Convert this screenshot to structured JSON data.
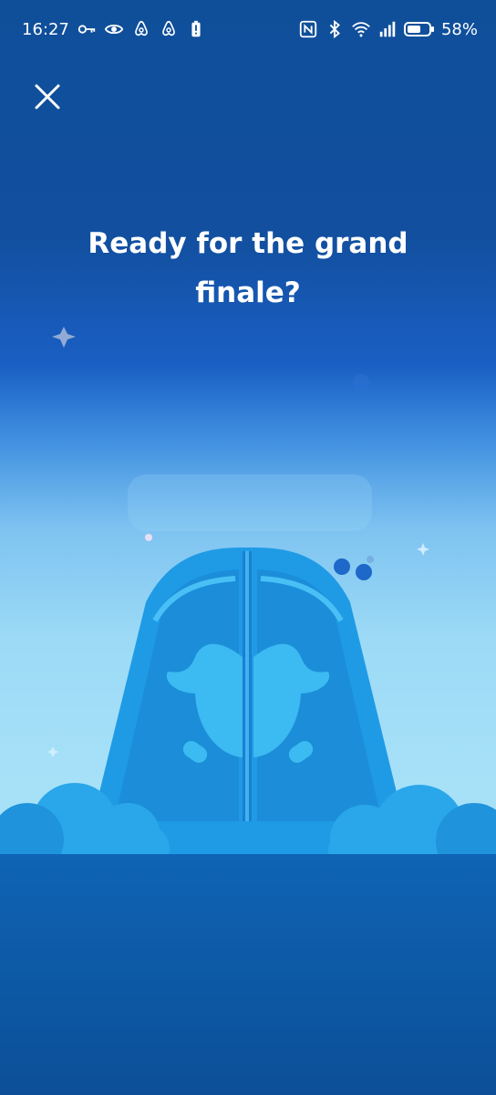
{
  "status_bar": {
    "time": "16:27",
    "battery_percent": "58%",
    "icons_left": [
      "key-icon",
      "eye-icon",
      "airbnb-icon",
      "airbnb-icon",
      "battery-alert-icon"
    ],
    "icons_right": [
      "nfc-icon",
      "bluetooth-icon",
      "wifi-icon",
      "signal-icon",
      "battery-icon"
    ]
  },
  "close": {
    "icon": "close-icon"
  },
  "main": {
    "title_line1": "Ready for the grand",
    "title_line2": "finale?"
  },
  "colors": {
    "background_top": "#0f4f9a",
    "background_bottom": "#a7e1f8",
    "door": "#1e9ae6",
    "ground": "#0d5aa6",
    "text": "#ffffff"
  }
}
